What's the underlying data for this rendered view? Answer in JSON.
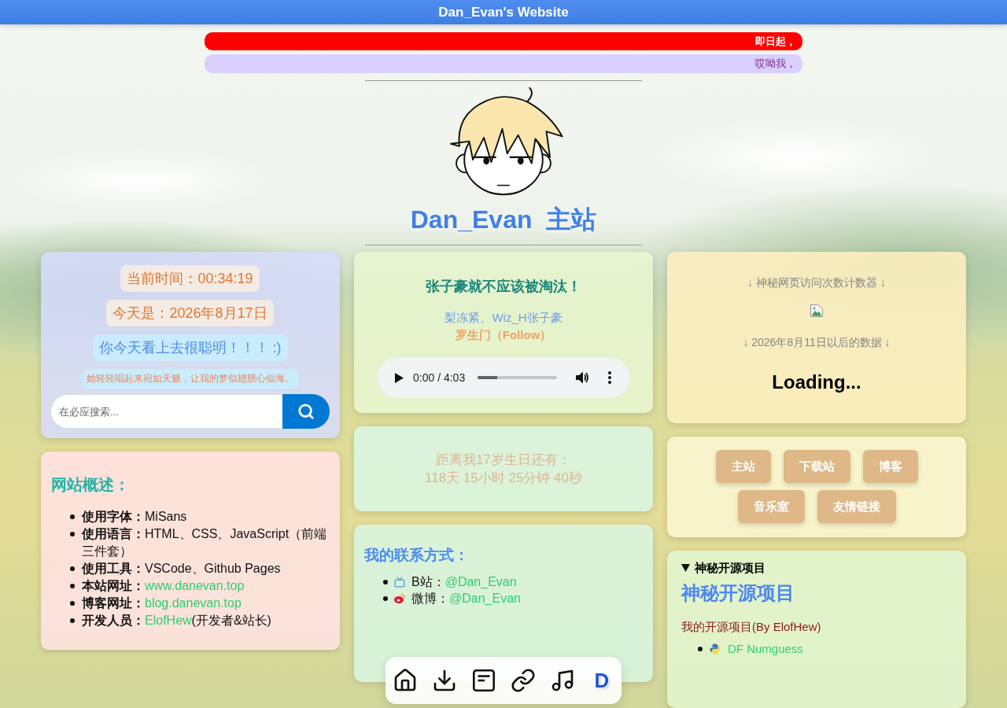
{
  "header": {
    "title": "Dan_Evan's Website"
  },
  "announcements": [
    {
      "kind": "alert",
      "text": "即日起，"
    },
    {
      "kind": "soft",
      "text": "哎呦我，"
    }
  ],
  "profile": {
    "title": "Dan_Evan  主站"
  },
  "clock": {
    "pills": [
      {
        "kind": "warm",
        "text": "当前时间：00:34:19"
      },
      {
        "kind": "warm",
        "text": "今天是：2026年8月17日"
      },
      {
        "kind": "cool",
        "text": "你今天看上去很聪明！！！ :)"
      },
      {
        "kind": "small",
        "text": "她轻轻唱起来宛如天籁，让我的梦似翅膀心似海。"
      }
    ],
    "search": {
      "placeholder": "在必应搜索..."
    }
  },
  "about": {
    "title": "网站概述：",
    "items": [
      {
        "label": "使用字体：",
        "value": "MiSans"
      },
      {
        "label": "使用语言：",
        "value": "HTML、CSS、JavaScript（前端三件套）"
      },
      {
        "label": "使用工具：",
        "value": "VSCode、Github Pages"
      },
      {
        "label": "本站网址：",
        "link": "www.danevan.top"
      },
      {
        "label": "博客网址：",
        "link": "blog.danevan.top"
      },
      {
        "label": "开发人员：",
        "link": "ElofHew",
        "value": "(开发者&站长)"
      }
    ]
  },
  "song": {
    "title": "张子豪就不应该被淘汰！",
    "artists": "梨冻紧、Wiz_H张子豪",
    "name": "罗生门（Follow）",
    "player": {
      "time": "0:00 / 4:03",
      "level": 0.25
    }
  },
  "countdown": {
    "lines": [
      "距离我17岁生日还有：",
      "118天 15小时 25分钟 40秒"
    ]
  },
  "contact": {
    "title": "我的联系方式：",
    "items": [
      {
        "kind": "tv",
        "label": "B站：",
        "handle": "@Dan_Evan"
      },
      {
        "kind": "weibo",
        "label": "微博：",
        "handle": "@Dan_Evan"
      }
    ]
  },
  "counter": {
    "title": "↓ 神秘网页访问次数计数器 ↓",
    "note": "↓ 2026年8月11日以后的数据 ↓",
    "status": "Loading..."
  },
  "nav": {
    "buttons": [
      "主站",
      "下载站",
      "博客",
      "音乐室",
      "友情链接"
    ]
  },
  "projects": {
    "summary": "神秘开源项目",
    "expanded": true,
    "heading": "神秘开源项目",
    "description": "我的开源项目(By ElofHew)",
    "items": [
      {
        "kind": "python",
        "name": "DF Numguess"
      }
    ]
  },
  "dock": {
    "items": [
      {
        "kind": "home"
      },
      {
        "kind": "download"
      },
      {
        "kind": "doc"
      },
      {
        "kind": "link"
      },
      {
        "kind": "music"
      },
      {
        "kind": "logo",
        "text": "D"
      }
    ]
  }
}
